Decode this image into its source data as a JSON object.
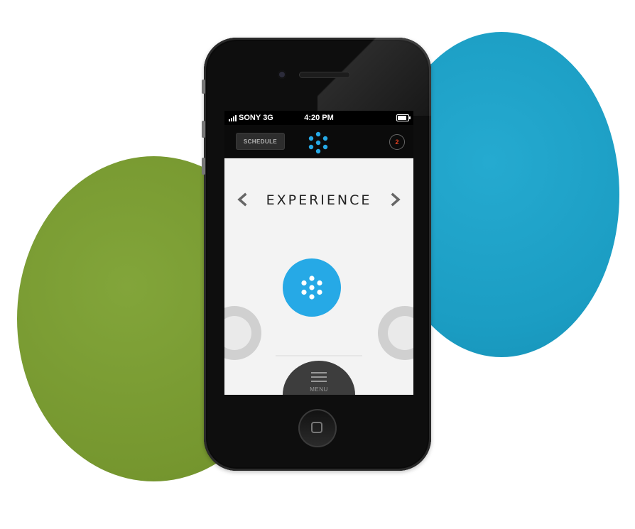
{
  "status_bar": {
    "carrier": "SONY",
    "network": "3G",
    "time": "4:20 PM"
  },
  "app_bar": {
    "schedule_label": "SCHEDULE",
    "notification_count": "2"
  },
  "main": {
    "section_title": "EXPERIENCE"
  },
  "menu": {
    "label": "MENU"
  },
  "colors": {
    "accent_blue": "#26a9e6",
    "badge_red": "#e04020",
    "green_blob": "#7a9c34",
    "blue_blob": "#1ea2c8"
  },
  "icons": {
    "logo": "dotted-flower-icon",
    "prev": "chevron-left-icon",
    "next": "chevron-right-icon",
    "menu": "hamburger-icon"
  }
}
